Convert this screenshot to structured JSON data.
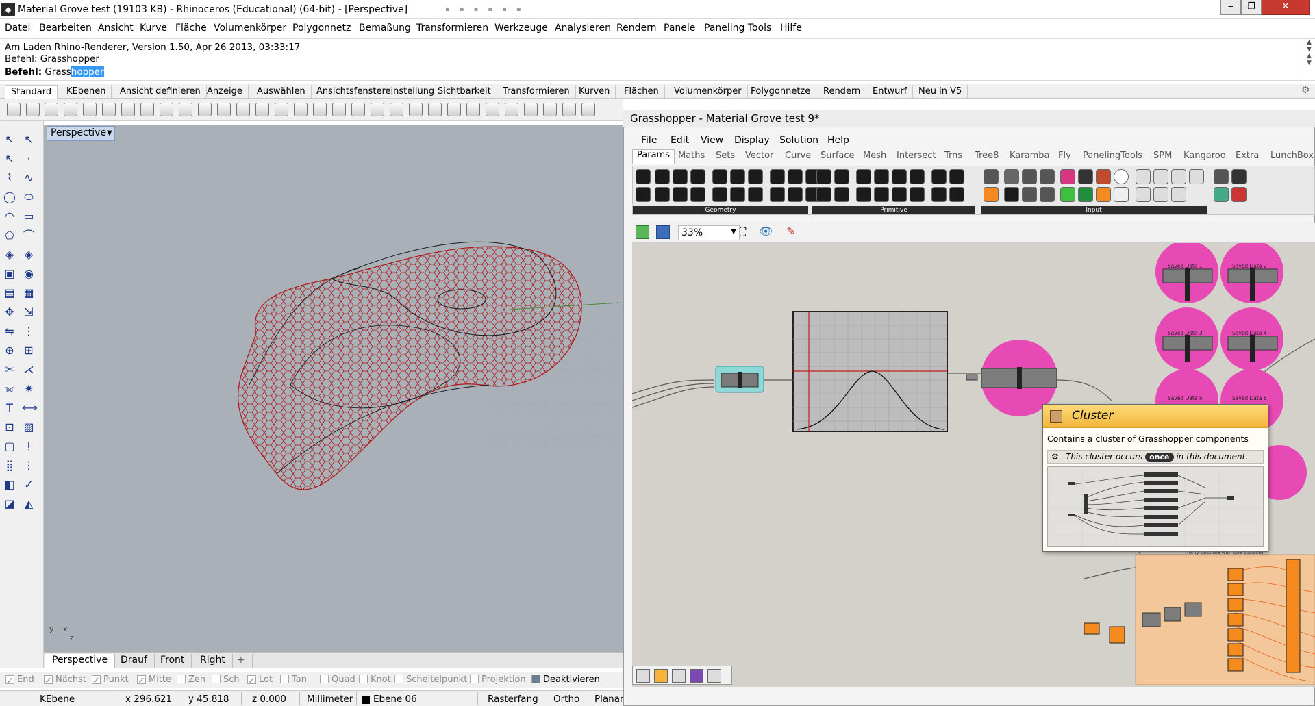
{
  "window": {
    "title": "Material Grove test (19103 KB) - Rhinoceros (Educational) (64-bit) - [Perspective]",
    "minimize": "‒",
    "maximize": "❐",
    "close": "✕"
  },
  "menu": [
    "Datei",
    "Bearbeiten",
    "Ansicht",
    "Kurve",
    "Fläche",
    "Volumenkörper",
    "Polygonnetz",
    "Bemaßung",
    "Transformieren",
    "Werkzeuge",
    "Analysieren",
    "Rendern",
    "Panele",
    "Paneling Tools",
    "Hilfe"
  ],
  "command_history": {
    "line1": "Am Laden Rhino-Renderer, Version 1.50, Apr 26 2013, 03:33:17",
    "line2": "Befehl: Grasshopper",
    "prompt_label": "Befehl:",
    "prompt_value_plain": "Grass",
    "prompt_value_selected": "hopper"
  },
  "toolbar_tabs": [
    "Standard",
    "KEbenen",
    "Ansicht definieren",
    "Anzeige",
    "Auswählen",
    "Ansichtsfenstereinstellung",
    "Sichtbarkeit",
    "Transformieren",
    "Kurven",
    "Flächen",
    "Volumenkörper",
    "Polygonnetze",
    "Rendern",
    "Entwurf",
    "Neu in V5"
  ],
  "viewport": {
    "label": "Perspective",
    "tabs": [
      "Perspective",
      "Drauf",
      "Front",
      "Right"
    ],
    "add_tab": "+",
    "axis_y": "y",
    "axis_x": "x",
    "axis_z": "z"
  },
  "osnaps": [
    {
      "label": "End",
      "checked": true
    },
    {
      "label": "Nächst",
      "checked": true
    },
    {
      "label": "Punkt",
      "checked": true
    },
    {
      "label": "Mitte",
      "checked": true
    },
    {
      "label": "Zen",
      "checked": false
    },
    {
      "label": "Sch",
      "checked": false
    },
    {
      "label": "Lot",
      "checked": true
    },
    {
      "label": "Tan",
      "checked": false
    },
    {
      "label": "Quad",
      "checked": false
    },
    {
      "label": "Knot",
      "checked": false
    },
    {
      "label": "Scheitelpunkt",
      "checked": false
    },
    {
      "label": "Projektion",
      "checked": false
    },
    {
      "label": "Deaktivieren",
      "checked": false
    }
  ],
  "status": {
    "layer_label": "KEbene",
    "x": "x 296.621",
    "y": "y 45.818",
    "z": "z 0.000",
    "units": "Millimeter",
    "layer": "Ebene 06",
    "snap": "Rasterfang",
    "ortho": "Ortho",
    "planar": "Planar"
  },
  "grasshopper": {
    "title": "Grasshopper - Material Grove test 9*",
    "menu": [
      "File",
      "Edit",
      "View",
      "Display",
      "Solution",
      "Help"
    ],
    "tabs": [
      "Params",
      "Maths",
      "Sets",
      "Vector",
      "Curve",
      "Surface",
      "Mesh",
      "Intersect",
      "Trns",
      "Tree8",
      "Karamba",
      "Fly",
      "PanelingTools",
      "SPM",
      "Kangaroo",
      "Extra",
      "LunchBox"
    ],
    "ribbon_groups": [
      "Geometry",
      "Primitive",
      "Input"
    ],
    "zoom": "33%",
    "saved_data": [
      "Saved Data 1",
      "Saved Data 2",
      "Saved Data 3",
      "Saved Data 4",
      "Saved Data 5",
      "Saved Data 6"
    ],
    "note": "(only possible with one surface)",
    "tooltip": {
      "title": "Cluster",
      "description": "Contains a cluster of Grasshopper components",
      "occurs_before": "This cluster occurs",
      "occurs_badge": "once",
      "occurs_after": "in this document."
    }
  },
  "colors": {
    "mesh": "#b01818",
    "node_pink": "#e84ab5",
    "node_orange": "#f58a1f",
    "cluster_box": "#f4c79b",
    "tooltip_header": "#f7c24a",
    "selection": "#3399ff"
  }
}
